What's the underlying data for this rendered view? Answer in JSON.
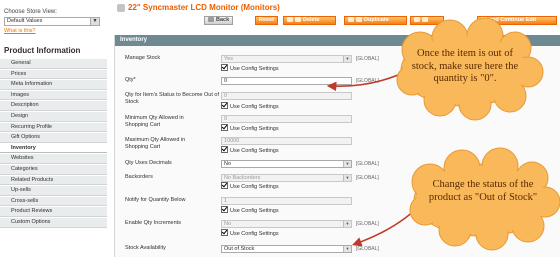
{
  "sidebar": {
    "store_label": "Choose Store View:",
    "store_value": "Default Values",
    "whatis": "What is this?",
    "title": "Product Information",
    "tabs": [
      "General",
      "Prices",
      "Meta Information",
      "Images",
      "Description",
      "Design",
      "Recurring Profile",
      "Gift Options",
      "Inventory",
      "Websites",
      "Categories",
      "Related Products",
      "Up-sells",
      "Cross-sells",
      "Product Reviews",
      "Custom Options"
    ],
    "active_tab": "Inventory"
  },
  "header": {
    "title": "22\" Syncmaster LCD Monitor (Monitors)",
    "buttons": {
      "back": "Back",
      "reset": "Reset",
      "delete": "Delete",
      "duplicate": "Duplicate",
      "save_edit": "and Continue Edit"
    }
  },
  "inventory": {
    "section_title": "Inventory",
    "use_config": "Use Config Settings",
    "scope": "[GLOBAL]",
    "manage_stock": {
      "label": "Manage Stock",
      "value": "Yes"
    },
    "qty": {
      "label": "Qty*",
      "value": "0"
    },
    "out_of_stock_qty": {
      "label": "Qty for Item's Status to Become Out of Stock",
      "value": "0"
    },
    "min_qty": {
      "label": "Minimum Qty Allowed in Shopping Cart",
      "value": "0"
    },
    "max_qty": {
      "label": "Maximum Qty Allowed in Shopping Cart",
      "value": "10000"
    },
    "decimals": {
      "label": "Qty Uses Decimals",
      "value": "No"
    },
    "backorders": {
      "label": "Backorders",
      "value": "No Backorders"
    },
    "notify": {
      "label": "Notify for Quantity Below",
      "value": "1"
    },
    "increments": {
      "label": "Enable Qty Increments",
      "value": "No"
    },
    "availability": {
      "label": "Stock Availability",
      "value": "Out of Stock"
    }
  },
  "annotations": {
    "top": "Once the item is out of stock, make sure here the quantity is \"0\".",
    "bottom": "Change the status of the product as \"Out of Stock\""
  },
  "colors": {
    "accent": "#eb5e00",
    "button": "#f77c16",
    "section_header": "#6f8992",
    "cloud": "#f9b85a",
    "arrow": "#c0392b"
  }
}
